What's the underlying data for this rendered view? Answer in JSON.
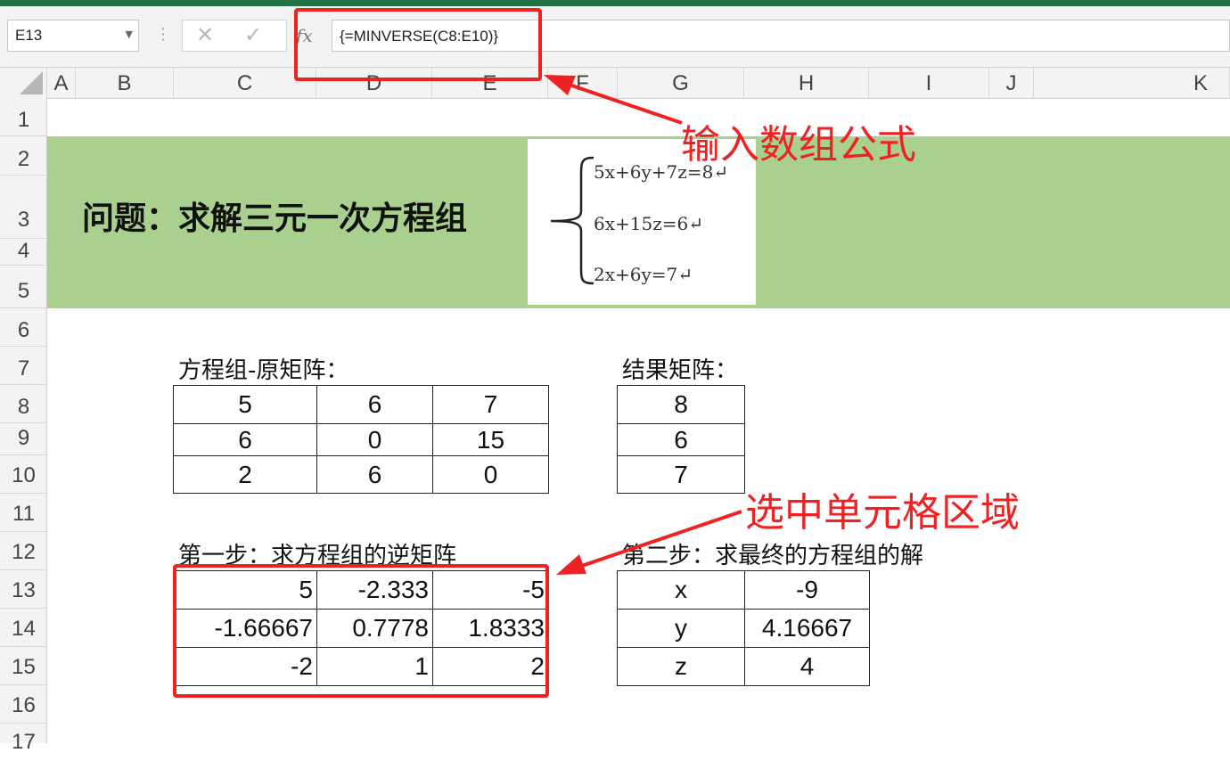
{
  "window": {
    "accent": "#217346"
  },
  "formula_bar": {
    "name_box": "E13",
    "cancel_icon": "✕",
    "enter_icon": "✓",
    "fx_label": "fx",
    "formula": "{=MINVERSE(C8:E10)}"
  },
  "columns": [
    "A",
    "B",
    "C",
    "D",
    "E",
    "F",
    "G",
    "H",
    "I",
    "J",
    "K"
  ],
  "rows": [
    "1",
    "2",
    "3",
    "4",
    "5",
    "6",
    "7",
    "8",
    "9",
    "10",
    "11",
    "12",
    "13",
    "14",
    "15",
    "16",
    "17"
  ],
  "sheet": {
    "title": "问题：求解三元一次方程组",
    "equations": [
      "5x+6y+7z=8↵",
      "6x+15z=6↵",
      "2x+6y=7↵"
    ],
    "matrix_label": "方程组-原矩阵：",
    "matrix": [
      [
        "5",
        "6",
        "7"
      ],
      [
        "6",
        "0",
        "15"
      ],
      [
        "2",
        "6",
        "0"
      ]
    ],
    "result_label": "结果矩阵：",
    "result": [
      "8",
      "6",
      "7"
    ],
    "step1_label": "第一步：求方程组的逆矩阵",
    "inverse": [
      [
        "5",
        "-2.333",
        "-5"
      ],
      [
        "-1.66667",
        "0.7778",
        "1.8333"
      ],
      [
        "-2",
        "1",
        "2"
      ]
    ],
    "step2_label": "第二步：求最终的方程组的解",
    "solution": [
      [
        "x",
        "-9"
      ],
      [
        "y",
        "4.16667"
      ],
      [
        "z",
        "4"
      ]
    ]
  },
  "annotations": {
    "formula_note": "输入数组公式",
    "range_note": "选中单元格区域",
    "color": "#ee2222"
  }
}
